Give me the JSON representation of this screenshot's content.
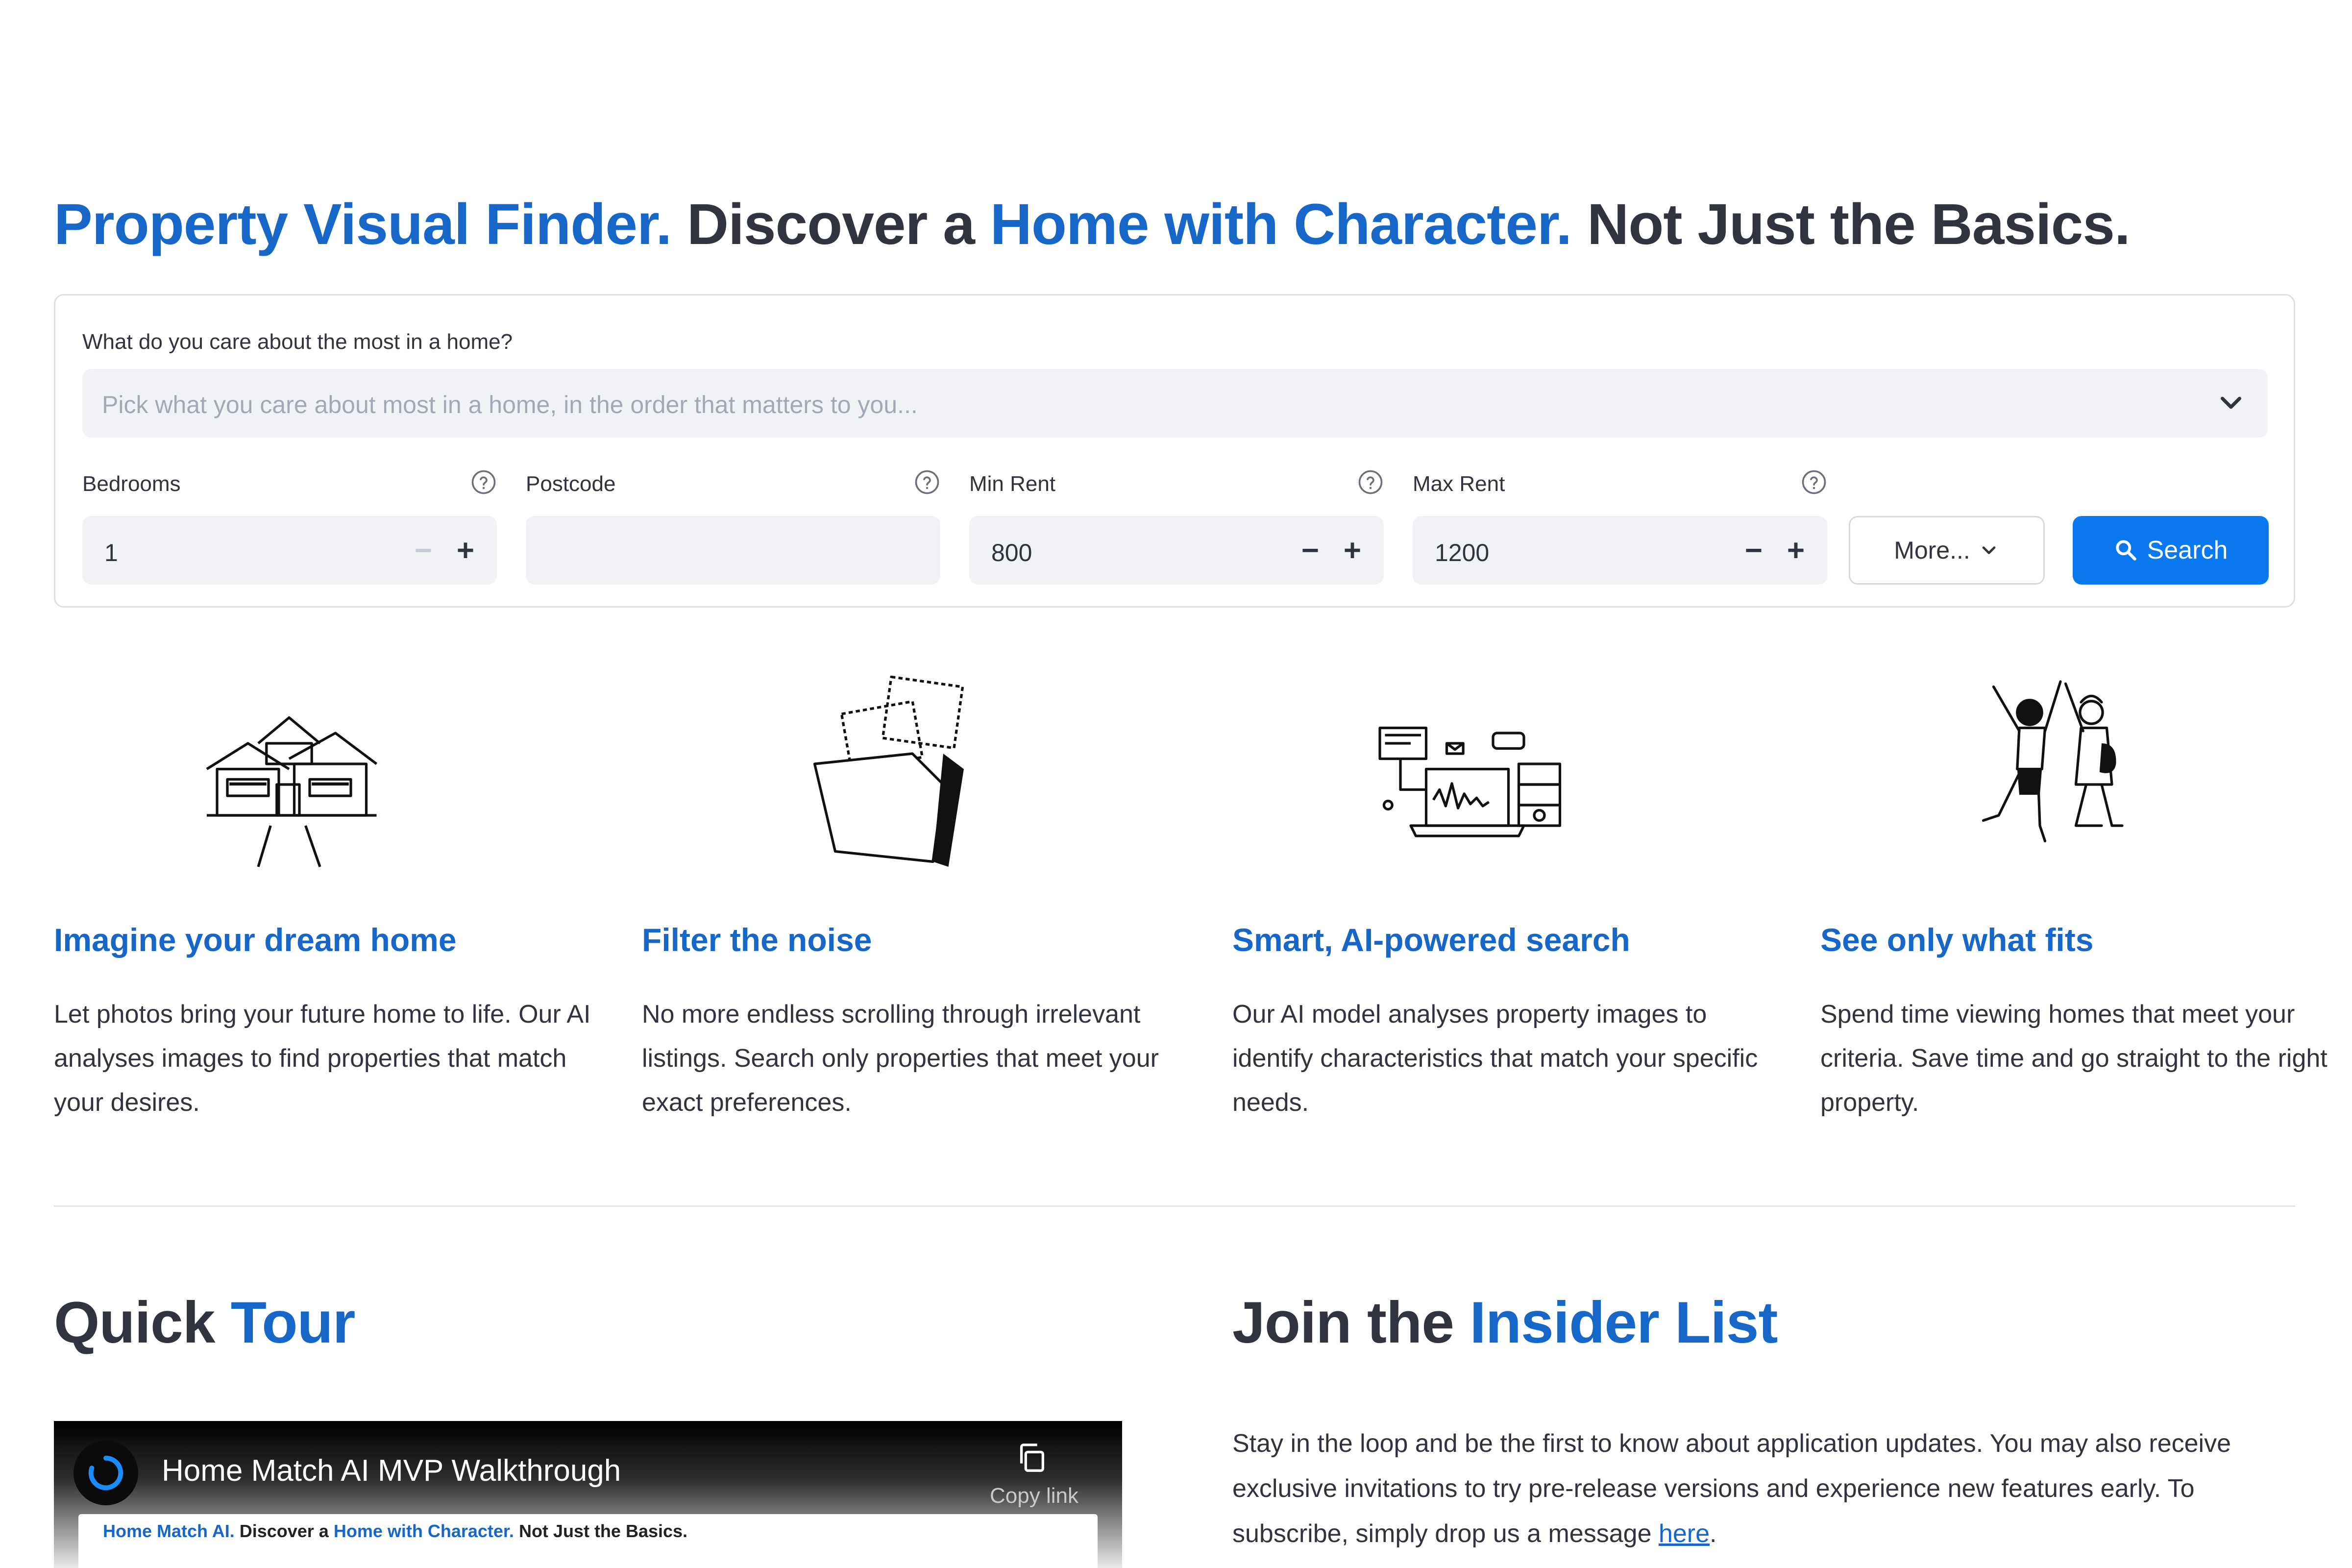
{
  "hero": {
    "part1": "Property Visual Finder.",
    "part2": " Discover a ",
    "part3": "Home with Character.",
    "part4": " Not Just the Basics."
  },
  "search": {
    "care_label": "What do you care about the most in a home?",
    "care_placeholder": "Pick what you care about most in a home, in the order that matters to you...",
    "fields": [
      {
        "label": "Bedrooms",
        "value": "1"
      },
      {
        "label": "Postcode",
        "value": ""
      },
      {
        "label": "Min Rent",
        "value": "800"
      },
      {
        "label": "Max Rent",
        "value": "1200"
      }
    ],
    "more_label": "More...",
    "search_label": "Search"
  },
  "features": [
    {
      "icon": "house-illustration",
      "title": "Imagine your dream home",
      "description": "Let photos bring your future home to life. Our AI analyses images to find properties that match your desires."
    },
    {
      "icon": "folder-photos-illustration",
      "title": "Filter the noise",
      "description": "No more endless scrolling through irrelevant listings. Search only properties that meet your exact preferences."
    },
    {
      "icon": "laptop-analytics-illustration",
      "title": "Smart, AI-powered search",
      "description": "Our AI model analyses property images to identify characteristics that match your specific needs."
    },
    {
      "icon": "high-five-illustration",
      "title": "See only what fits",
      "description": "Spend time viewing homes that meet your criteria. Save time and go straight to the right property."
    }
  ],
  "tour": {
    "title_part1": "Quick ",
    "title_part2": "Tour",
    "video_title": "Home Match AI MVP Walkthrough",
    "copy_link": "Copy link",
    "inner_part1": "Home Match AI.",
    "inner_part2": " Discover a ",
    "inner_part3": "Home with Character.",
    "inner_part4": " Not Just the Basics."
  },
  "insider": {
    "title_part1": "Join the ",
    "title_part2": "Insider List",
    "text": "Stay in the loop and be the first to know about application updates. You may also receive exclusive invitations to try pre-release versions and experience new features early. To subscribe, simply drop us a message ",
    "link_text": "here",
    "text_end": "."
  },
  "colors": {
    "accent": "#1667c7",
    "primary_button": "#0a78ee",
    "text": "#31333f",
    "input_bg": "#f0f2f6"
  }
}
